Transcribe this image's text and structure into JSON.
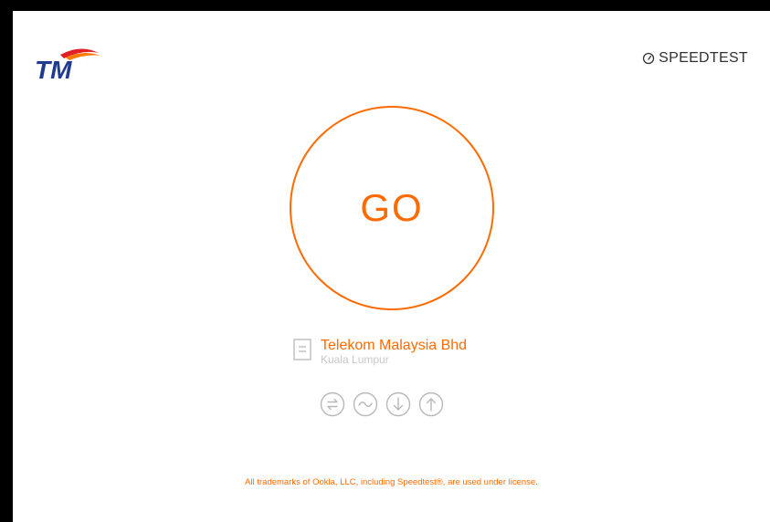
{
  "header": {
    "logo_icon": "tm-logo",
    "brand_icon": "speedtest-gauge-icon",
    "brand_label": "SPEEDTEST"
  },
  "main": {
    "go_label": "GO"
  },
  "server": {
    "icon": "server-icon",
    "name": "Telekom Malaysia Bhd",
    "location": "Kuala Lumpur"
  },
  "metrics": {
    "icons": [
      "ping-icon",
      "jitter-icon",
      "download-icon",
      "upload-icon"
    ]
  },
  "footer": {
    "text": "All trademarks of Ookla, LLC, including Speedtest®, are used under license."
  },
  "colors": {
    "accent": "#ff6b00",
    "text_dark": "#333333",
    "text_muted": "#c8c8c8",
    "icon_gray": "#b8b8b8",
    "logo_blue": "#1f3c8f",
    "logo_red": "#e21e26"
  }
}
